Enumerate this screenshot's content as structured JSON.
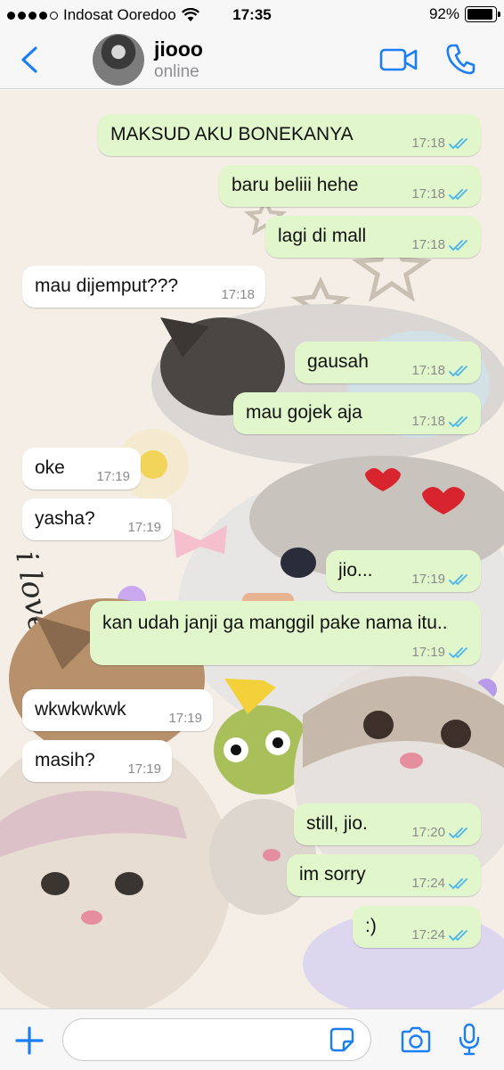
{
  "status_bar": {
    "carrier": "Indosat Ooredoo",
    "time": "17:35",
    "battery": "92%",
    "battery_level": 0.92
  },
  "header": {
    "contact_name": "jiooo",
    "contact_status": "online",
    "back_icon": "chevron-left-icon",
    "video_icon": "video-camera-icon",
    "call_icon": "phone-icon"
  },
  "messages": [
    {
      "text": "MAKSUD AKU BONEKANYA",
      "time": "17:18",
      "dir": "out"
    },
    {
      "text": "baru beliii hehe",
      "time": "17:18",
      "dir": "out"
    },
    {
      "text": "lagi di mall",
      "time": "17:18",
      "dir": "out"
    },
    {
      "text": "mau dijemput???",
      "time": "17:18",
      "dir": "in"
    },
    {
      "text": "gausah",
      "time": "17:18",
      "dir": "out"
    },
    {
      "text": "mau gojek aja",
      "time": "17:18",
      "dir": "out"
    },
    {
      "text": "oke",
      "time": "17:19",
      "dir": "in"
    },
    {
      "text": "yasha?",
      "time": "17:19",
      "dir": "in"
    },
    {
      "text": "jio...",
      "time": "17:19",
      "dir": "out"
    },
    {
      "text": "kan udah janji ga manggil pake nama itu..",
      "time": "17:19",
      "dir": "out"
    },
    {
      "text": "wkwkwkwk",
      "time": "17:19",
      "dir": "in"
    },
    {
      "text": "masih?",
      "time": "17:19",
      "dir": "in"
    },
    {
      "text": "still, jio.",
      "time": "17:20",
      "dir": "out"
    },
    {
      "text": "im sorry",
      "time": "17:24",
      "dir": "out"
    },
    {
      "text": ":)",
      "time": "17:24",
      "dir": "out"
    }
  ],
  "input_bar": {
    "placeholder": "",
    "icons": [
      "plus-icon",
      "sticker-icon",
      "camera-icon",
      "microphone-icon"
    ]
  },
  "colors": {
    "accent": "#1a7ef5",
    "outgoing_bubble": "#e1f7cb",
    "incoming_bubble": "#ffffff",
    "read_ticks": "#4fb6ec"
  }
}
